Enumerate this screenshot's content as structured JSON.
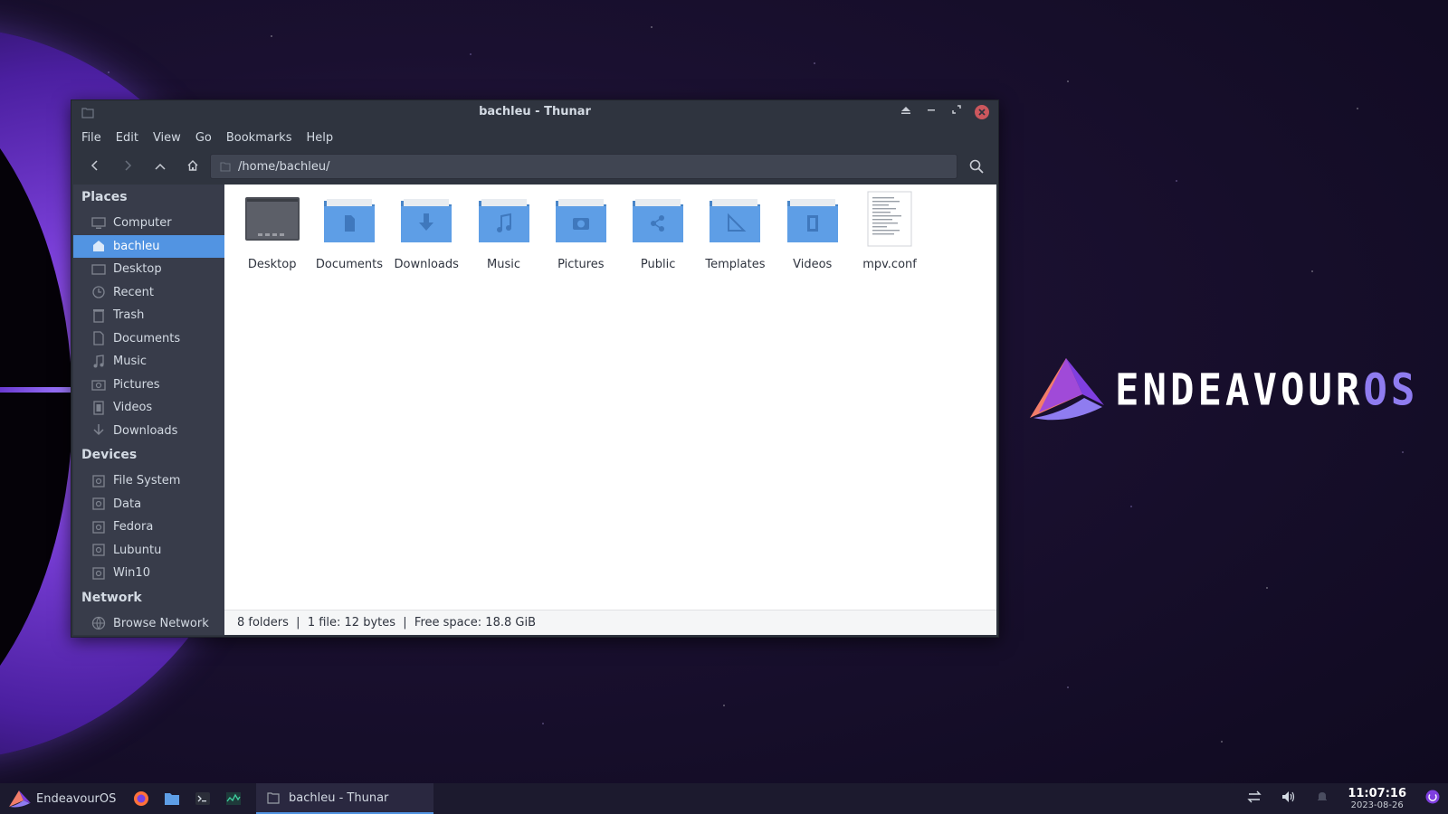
{
  "window": {
    "title": "bachleu - Thunar",
    "menu": [
      "File",
      "Edit",
      "View",
      "Go",
      "Bookmarks",
      "Help"
    ],
    "path": "/home/bachleu/"
  },
  "sidebar": {
    "places_heading": "Places",
    "places": [
      {
        "label": "Computer",
        "icon": "computer-icon"
      },
      {
        "label": "bachleu",
        "icon": "home-icon",
        "active": true
      },
      {
        "label": "Desktop",
        "icon": "desktop-icon"
      },
      {
        "label": "Recent",
        "icon": "recent-icon"
      },
      {
        "label": "Trash",
        "icon": "trash-icon"
      },
      {
        "label": "Documents",
        "icon": "documents-icon"
      },
      {
        "label": "Music",
        "icon": "music-icon"
      },
      {
        "label": "Pictures",
        "icon": "pictures-icon"
      },
      {
        "label": "Videos",
        "icon": "videos-icon"
      },
      {
        "label": "Downloads",
        "icon": "downloads-icon"
      }
    ],
    "devices_heading": "Devices",
    "devices": [
      {
        "label": "File System",
        "icon": "drive-icon"
      },
      {
        "label": "Data",
        "icon": "drive-icon"
      },
      {
        "label": "Fedora",
        "icon": "drive-icon"
      },
      {
        "label": "Lubuntu",
        "icon": "drive-icon"
      },
      {
        "label": "Win10",
        "icon": "drive-icon"
      }
    ],
    "network_heading": "Network",
    "network": [
      {
        "label": "Browse Network",
        "icon": "network-icon"
      }
    ]
  },
  "files": [
    {
      "name": "Desktop",
      "type": "desktop-folder"
    },
    {
      "name": "Documents",
      "type": "documents-folder"
    },
    {
      "name": "Downloads",
      "type": "downloads-folder"
    },
    {
      "name": "Music",
      "type": "music-folder"
    },
    {
      "name": "Pictures",
      "type": "pictures-folder"
    },
    {
      "name": "Public",
      "type": "public-folder"
    },
    {
      "name": "Templates",
      "type": "templates-folder"
    },
    {
      "name": "Videos",
      "type": "videos-folder"
    },
    {
      "name": "mpv.conf",
      "type": "text-file"
    }
  ],
  "status": "8 folders  |  1 file: 12 bytes  |  Free space: 18.8 GiB",
  "taskbar": {
    "start_label": "EndeavourOS",
    "task_label": "bachleu - Thunar",
    "time": "11:07:16",
    "date": "2023-08-26"
  },
  "desktop": {
    "logo_main": "ENDEAVOUR",
    "logo_suffix": "OS"
  },
  "colors": {
    "accent": "#5294e2",
    "folder": "#5e9ee6",
    "window_bg": "#2f343f",
    "sidebar_bg": "#383c4a"
  }
}
